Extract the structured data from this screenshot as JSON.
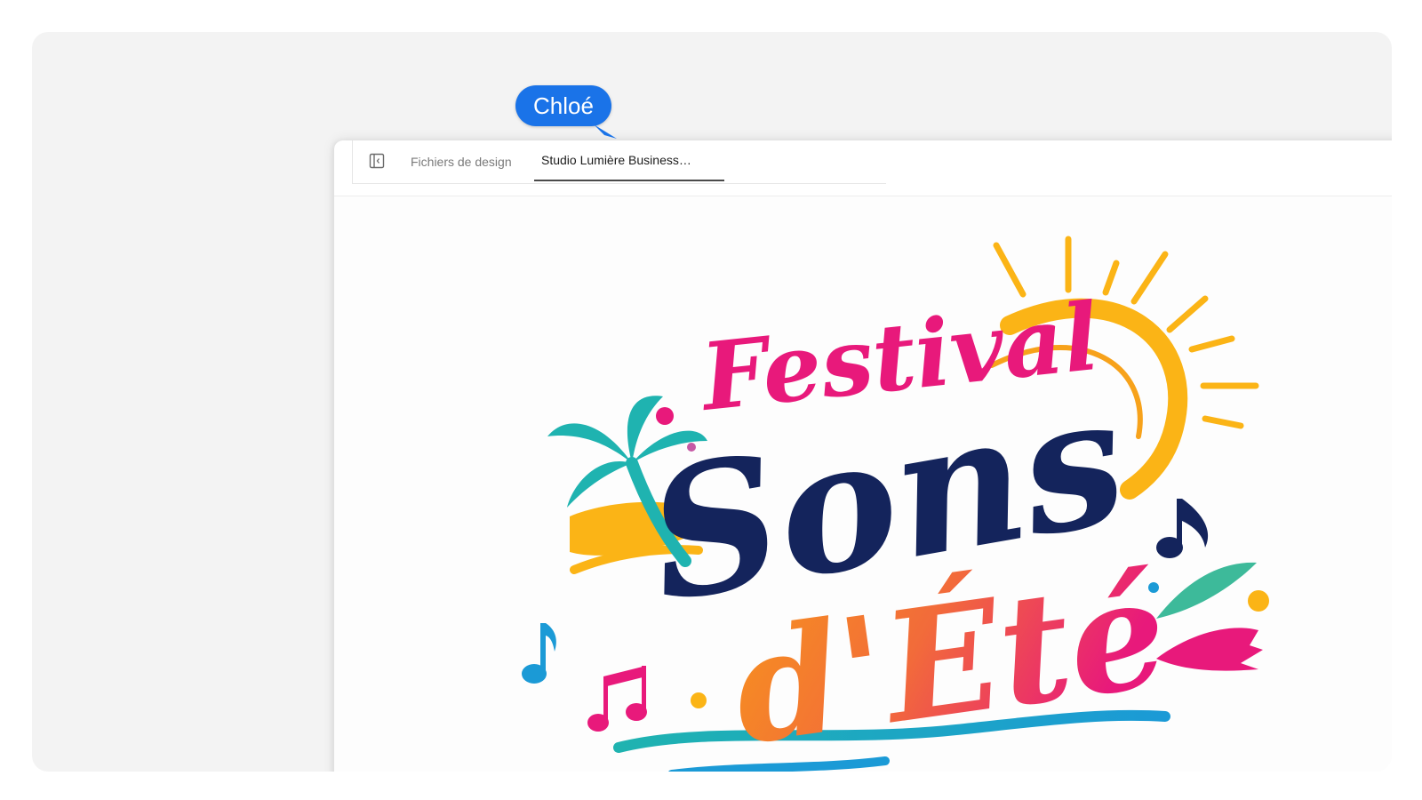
{
  "tabs": {
    "files_label": "Fichiers de design",
    "document_label": "Studio Lumière Business…"
  },
  "collaborator": {
    "name": "Chloé",
    "color": "#1a73e8"
  },
  "artwork": {
    "line1": "Festival",
    "line2": "Sons",
    "line3": "d'Été",
    "colors": {
      "festival": "#e8197b",
      "sons": "#14245c",
      "ete_start": "#f7941d",
      "ete_end": "#e8197b",
      "sun": "#fbb416",
      "palm": "#1fb3b0",
      "wave": "#1b9ad6"
    }
  },
  "icons": {
    "sidebar_toggle": "sidebar-panel-icon",
    "cursor": "cursor-arrow-icon"
  }
}
